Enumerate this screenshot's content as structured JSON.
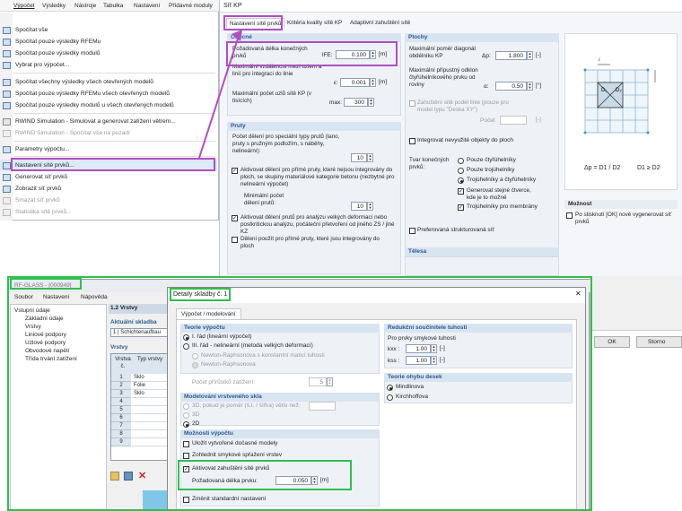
{
  "menu_window": {
    "menubar": [
      "Výpočet",
      "Výsledky",
      "Nástroje",
      "Tabulka",
      "Nastavení",
      "Přídavné moduly"
    ],
    "items": [
      {
        "label": "Spočítat vše",
        "disabled": false
      },
      {
        "label": "Spočítat pouze výsledky RFEMu",
        "disabled": false
      },
      {
        "label": "Spočítat pouze výsledky modulů",
        "disabled": false
      },
      {
        "label": "Vybrat pro výpočet...",
        "disabled": false
      },
      {
        "label": "Spočítat všechny výsledky všech otevřených modelů",
        "disabled": false
      },
      {
        "label": "Spočítat pouze výsledky RFEMu všech otevřených modelů",
        "disabled": false
      },
      {
        "label": "Spočítat pouze výsledky modulů u všech otevřených modelů",
        "disabled": false
      },
      {
        "label": "RWIND Simulation - Simulovat a generovat zatížení větrem...",
        "disabled": false
      },
      {
        "label": "RWIND Simulation - Spočítat vše na pozadí",
        "disabled": true
      },
      {
        "label": "Parametry výpočtu...",
        "disabled": false
      },
      {
        "label": "Nastavení sítě prvků...",
        "disabled": false,
        "highlighted": true
      },
      {
        "label": "Generovat síť prvků",
        "disabled": false
      },
      {
        "label": "Zobrazit síť prvků",
        "disabled": false
      },
      {
        "label": "Smazat síť prvků",
        "disabled": true
      },
      {
        "label": "Statistika sítě prvků...",
        "disabled": true
      }
    ]
  },
  "fe_dialog": {
    "title": "Síť KP",
    "tabs": [
      "Nastavení sítě prvků",
      "Kritéria kvality sítě KP",
      "Adaptivní zahuštění sítě"
    ],
    "obecne": {
      "header": "Obecné",
      "target_label": "Požadovaná délka konečných prvků",
      "target_symbol": "lFE:",
      "target_value": "0.100",
      "target_unit": "[m]",
      "max_dist_label": "Maximální vzdálenost mezi uzlem a linií pro integraci do linie",
      "max_dist_symbol": "ε:",
      "max_dist_value": "0.001",
      "max_dist_unit": "[m]",
      "max_fe_label": "Maximální počet uzlů sítě KP (v tisících)",
      "max_fe_symbol": "max:",
      "max_fe_value": "300"
    },
    "pruty": {
      "header": "Pruty",
      "division_label": "Počet dělení pro speciální typy prutů (lano, pruty s pružným podložím, s náběhy, nelineární):",
      "division_value": "10",
      "activate_straight": "Aktivovat dělení pro přímé pruty, které nejsou integrovány do ploch, se skupiny materiálové kategorie betonu (nezbytné pro nelineární výpočet)",
      "min_division_label": "Minimální počet dělení prutů:",
      "min_division_value": "10",
      "activate_large": "Aktivovat dělení prutů pro analýzu velkých deformací nebo postkritickou analýzu, počáteční přetvoření od jiného ZS / jiné KZ",
      "use_division": "Dělení použít pro přímé pruty, které jsou integrovány do ploch"
    },
    "plochy": {
      "header": "Plochy",
      "max_ratio_label": "Maximální poměr diagonál obdélníku KP",
      "max_ratio_symbol": "Δp:",
      "max_ratio_value": "1.800",
      "max_ratio_unit": "[-]",
      "max_out_label": "Maximální přípustný odklon čtyřúhelníkového prvku od roviny",
      "max_out_symbol": "α:",
      "max_out_value": "0.50",
      "max_out_unit": "[°]",
      "shell_label": "Zahuštění sítě podél linie (pouze pro model typu \"Deska XY\")",
      "points_label": "Počet",
      "points_unit": "[-]",
      "integrate_label": "Integrovat nevyužité objekty do ploch",
      "shape_label": "Tvar konečných prvků:",
      "shape_options": [
        "Pouze čtyřúhelníky",
        "Pouze trojúhelníky",
        "Trojúhelníky a čtyřúhelníky"
      ],
      "same_squares": "Generovat stejné čtverce, kde je to možné",
      "triangles_membrane": "Trojúhelníky pro membrány",
      "structured": "Preferovaná strukturovaná síť"
    },
    "telesa_header": "Tělesa",
    "options_header": "Možnost",
    "options_text": "Po stisknutí [OK] nově vygenerovat síť prvků",
    "formula": "Δp = D1 / D2",
    "formula_right": "D1 ≥ D2",
    "ok_label": "OK",
    "cancel_label": "Storno"
  },
  "rfglass": {
    "title": "RF-GLASS - [000949]",
    "menubar": [
      "Soubor",
      "Nastavení",
      "Nápověda"
    ],
    "tree_root": "Vstupní údaje",
    "tree_items": [
      "Základní údaje",
      "Vrstvy",
      "Liniové podpory",
      "Uzlové podpory",
      "Obvodové napětí",
      "Třída trvání zatížení"
    ],
    "section_header": "1.2 Vrstvy",
    "composition_label": "Aktuální skladba",
    "composition_value": "1 | Schichtenaufbau",
    "layers_label": "Vrstvy",
    "col_layer": "Vrstva č.",
    "col_type": "Typ vrstvy",
    "rows": [
      {
        "no": "1",
        "type": "Sklo"
      },
      {
        "no": "2",
        "type": "Fólie"
      },
      {
        "no": "3",
        "type": "Sklo"
      },
      {
        "no": "4",
        "type": ""
      },
      {
        "no": "5",
        "type": ""
      },
      {
        "no": "6",
        "type": ""
      },
      {
        "no": "7",
        "type": ""
      },
      {
        "no": "8",
        "type": ""
      },
      {
        "no": "9",
        "type": ""
      }
    ]
  },
  "composition_dialog": {
    "title": "Detaily skladby č. 1",
    "tab": "Výpočet / modelování",
    "theory": {
      "header": "Teorie výpočtu",
      "opt1": "I. řád (lineární výpočet)",
      "opt2": "III. řád - nelineární (metoda velkých deformací)",
      "sub1": "Newton-Raphsonova s konstantní maticí tuhosti",
      "sub2": "Newton-Raphsonova",
      "increments_label": "Počet přírůstků zatížení:",
      "increments_value": "5"
    },
    "modeling": {
      "header": "Modelování vrstveného skla",
      "opt3d_ratio": "3D, pokud je poměr (š.t. / šířka) větší než:",
      "opt3d": "3D",
      "opt2d": "2D"
    },
    "options": {
      "header": "Možnosti výpočtu",
      "save_temp": "Uložit vytvořené dočasné modely",
      "shear": "Zohlednit smykové spřažení vrstev",
      "refine": "Aktivovat zahuštění sítě prvků",
      "target_label": "Požadovaná délka prvku:",
      "target_value": "0.050",
      "target_unit": "[m]",
      "change_default": "Změnit standardní nastavení"
    },
    "stiffness": {
      "header": "Redukční součinitele tuhosti",
      "for_label": "Pro prvky smykové tuhosti",
      "kxx_label": "kxx :",
      "kxx_value": "1.00",
      "kss_label": "kss :",
      "kss_value": "1.00",
      "unit": "[-]"
    },
    "plate": {
      "header": "Teorie ohybu desek",
      "opt1": "Mindlinova",
      "opt2": "Kirchhoffova"
    },
    "close_glyph": "✕"
  }
}
